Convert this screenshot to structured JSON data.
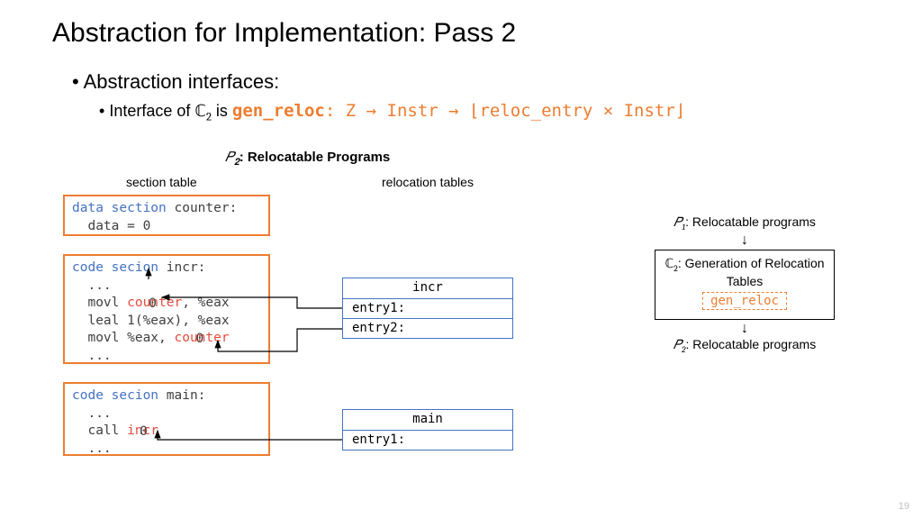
{
  "title": "Abstraction for Implementation: Pass 2",
  "bullet1": "Abstraction interfaces:",
  "bullet2_prefix": "Interface of ",
  "bullet2_c2": "ℂ",
  "bullet2_c2_sub": "2",
  "bullet2_is": " is ",
  "gen_reloc_name": "gen_reloc",
  "gen_reloc_sig": ": Z → Instr → ⌊reloc_entry × Instr⌋",
  "p2_heading_math": "𝑃",
  "p2_heading_sub": "𝟐",
  "p2_heading_rest": ": Relocatable Programs",
  "col_section": "section table",
  "col_reloc": "relocation tables",
  "code_data": {
    "kw": "data section",
    "name": " counter:",
    "l2": "  data = 0"
  },
  "code_incr": {
    "kw": "code secion",
    "name": " incr:",
    "l2": "  ...",
    "l3a": "  movl ",
    "l3sym": "counter",
    "l3zero": "0",
    "l3b": ", %eax",
    "l4": "  leal 1(%eax), %eax",
    "l5a": "  movl %eax, ",
    "l5sym": "counter",
    "l5zero": "0",
    "l6": "  ..."
  },
  "code_main": {
    "kw": "code secion",
    "name": " main:",
    "l2": "  ...",
    "l3a": "  call ",
    "l3sym": "incr",
    "l3zero": "0",
    "l4": "  ..."
  },
  "reloc_incr": {
    "title": "incr",
    "r1": "entry1:",
    "r2": "entry2:"
  },
  "reloc_main": {
    "title": "main",
    "r1": "entry1:"
  },
  "flow": {
    "p1": "𝑃",
    "p1_sub": "1",
    "p1_rest": ": Relocatable programs",
    "c2": "ℂ",
    "c2_sub": "2",
    "c2_rest": ": Generation of Relocation Tables",
    "gen_reloc": "gen_reloc",
    "p2": "𝑃",
    "p2_sub": "2",
    "p2_rest": ": Relocatable programs"
  },
  "page_num": "19"
}
